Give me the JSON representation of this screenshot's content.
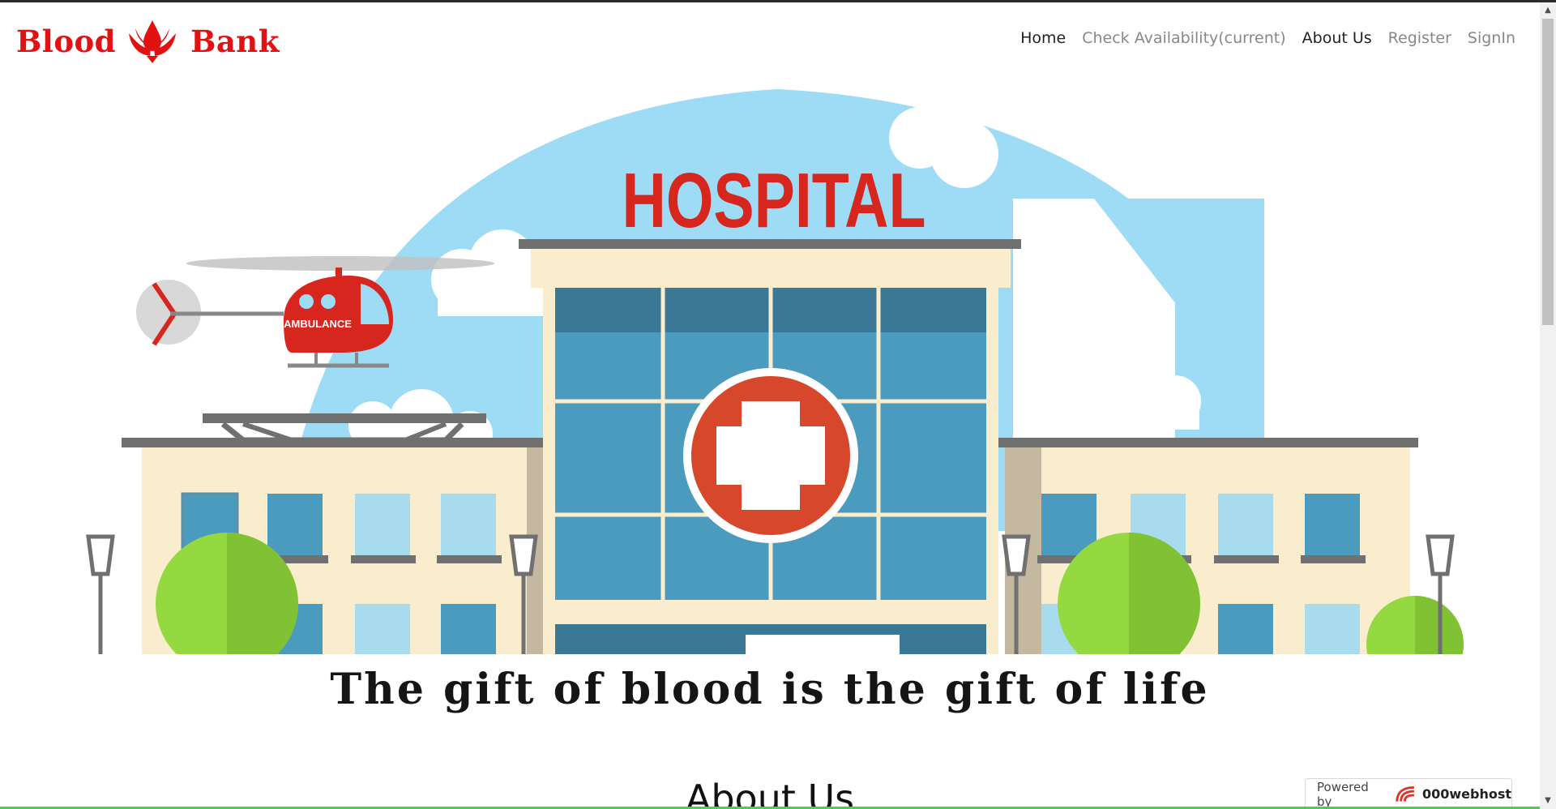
{
  "brand": {
    "word1": "Blood",
    "word2": "Bank",
    "logo_icon": "blood-drop-hands-icon",
    "color": "#e21212"
  },
  "nav": {
    "items": [
      {
        "label": "Home",
        "active": true
      },
      {
        "label": "Check Availability(current)",
        "active": false
      },
      {
        "label": "About Us",
        "active": true
      },
      {
        "label": "Register",
        "active": false
      },
      {
        "label": "SignIn",
        "active": false
      }
    ]
  },
  "hero": {
    "sign_text": "HOSPITAL",
    "helicopter_text": "AMBULANCE",
    "colors": {
      "sky": "#9edcf5",
      "red": "#d7261e",
      "glass": "#4a9bbd",
      "wall": "#faedce",
      "tree": "#8cd13d"
    }
  },
  "tagline": "The gift of blood is the gift of life",
  "section_title": "About Us",
  "footer_badge": {
    "powered_label": "Powered by",
    "brand": "000webhost",
    "logo_icon": "000webhost-logo-icon"
  }
}
